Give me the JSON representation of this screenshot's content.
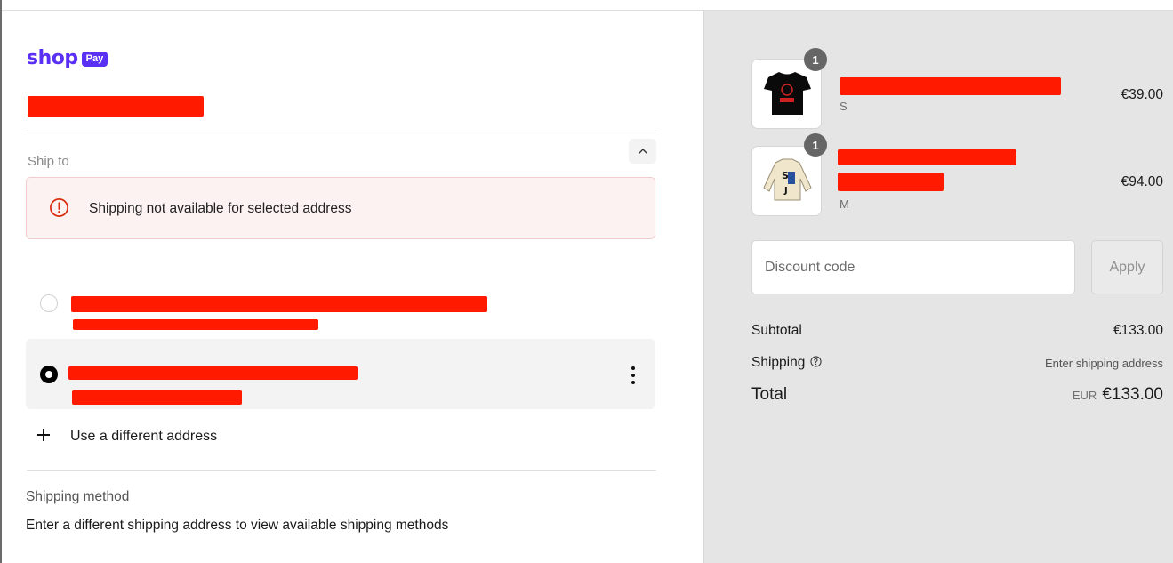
{
  "brand": {
    "word": "shop",
    "badge": "Pay",
    "color": "#5a31f4"
  },
  "ship_to": {
    "label": "Ship to",
    "error_message": "Shipping not available for selected address",
    "addresses": [
      {
        "selected": false
      },
      {
        "selected": true
      }
    ],
    "use_different": "Use a different address"
  },
  "shipping_method": {
    "label": "Shipping method",
    "text": "Enter a different shipping address to view available shipping methods"
  },
  "order": {
    "items": [
      {
        "quantity": "1",
        "variant": "S",
        "price": "€39.00",
        "image": "black-tshirt-thumbnail"
      },
      {
        "quantity": "1",
        "variant": "M",
        "price": "€94.00",
        "image": "cream-jacket-thumbnail"
      }
    ],
    "discount": {
      "placeholder": "Discount code",
      "button": "Apply"
    },
    "subtotal_label": "Subtotal",
    "subtotal_value": "€133.00",
    "shipping_label": "Shipping",
    "shipping_value": "Enter shipping address",
    "total_label": "Total",
    "total_currency": "EUR",
    "total_value": "€133.00"
  },
  "colors": {
    "error": "#d72c0d",
    "redaction": "#ff1a00",
    "summary_bg": "#e5e5e5"
  }
}
